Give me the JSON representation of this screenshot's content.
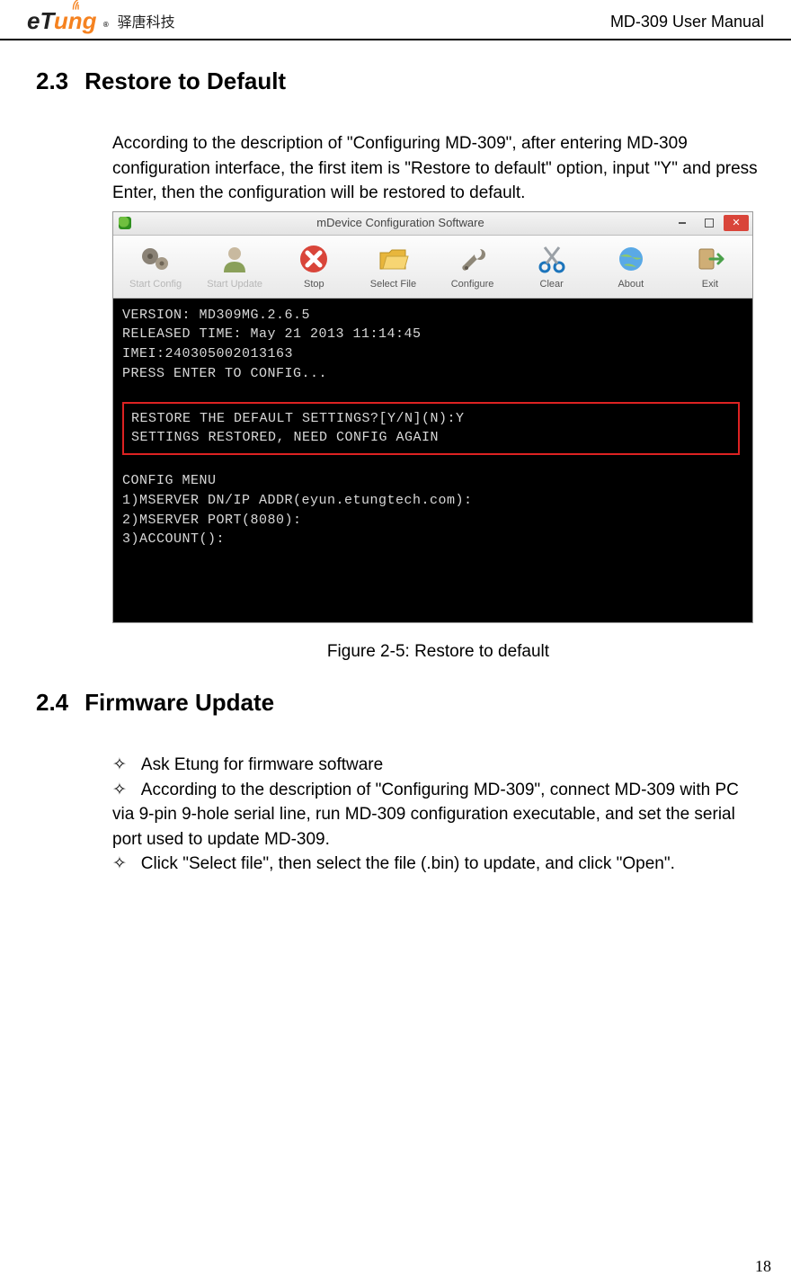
{
  "header": {
    "logo_text_1": "eT",
    "logo_text_2": "ung",
    "logo_cn": "驿唐科技",
    "doc_title": "MD-309 User Manual"
  },
  "section_23": {
    "number": "2.3",
    "title": "Restore to Default",
    "paragraph": "According to the description of \"Configuring MD-309\", after entering MD-309 configuration interface, the first item is \"Restore to default\" option, input \"Y\" and press Enter, then the configuration will be restored to default.",
    "figure_caption": "Figure 2-5: Restore to default"
  },
  "app_window": {
    "title": "mDevice Configuration Software",
    "toolbar": [
      {
        "label": "Start Config",
        "icon": "gears-icon"
      },
      {
        "label": "Start Update",
        "icon": "user-icon"
      },
      {
        "label": "Stop",
        "icon": "stop-x-icon"
      },
      {
        "label": "Select File",
        "icon": "folder-icon"
      },
      {
        "label": "Configure",
        "icon": "wrench-icon"
      },
      {
        "label": "Clear",
        "icon": "scissors-icon"
      },
      {
        "label": "About",
        "icon": "globe-icon"
      },
      {
        "label": "Exit",
        "icon": "exit-icon"
      }
    ],
    "terminal": {
      "version_line": "VERSION: MD309MG.2.6.5",
      "released_line": "RELEASED TIME: May 21 2013 11:14:45",
      "imei_line": "IMEI:240305002013163",
      "press_line": "PRESS ENTER TO CONFIG...",
      "restore_q": "RESTORE THE DEFAULT SETTINGS?[Y/N](N):Y",
      "restore_r": "SETTINGS RESTORED, NEED CONFIG AGAIN",
      "menu_header": "CONFIG MENU",
      "menu_1": "1)MSERVER DN/IP ADDR(eyun.etungtech.com):",
      "menu_2": "2)MSERVER PORT(8080):",
      "menu_3": "3)ACCOUNT():"
    }
  },
  "section_24": {
    "number": "2.4",
    "title": "Firmware Update",
    "bullets": [
      "Ask Etung for firmware software",
      "According to the description of \"Configuring MD-309\", connect MD-309 with PC via 9-pin 9-hole serial line, run MD-309 configuration executable, and set the serial port used to update MD-309.",
      "Click \"Select file\", then select the file (.bin) to update, and click \"Open\"."
    ]
  },
  "page_number": "18"
}
